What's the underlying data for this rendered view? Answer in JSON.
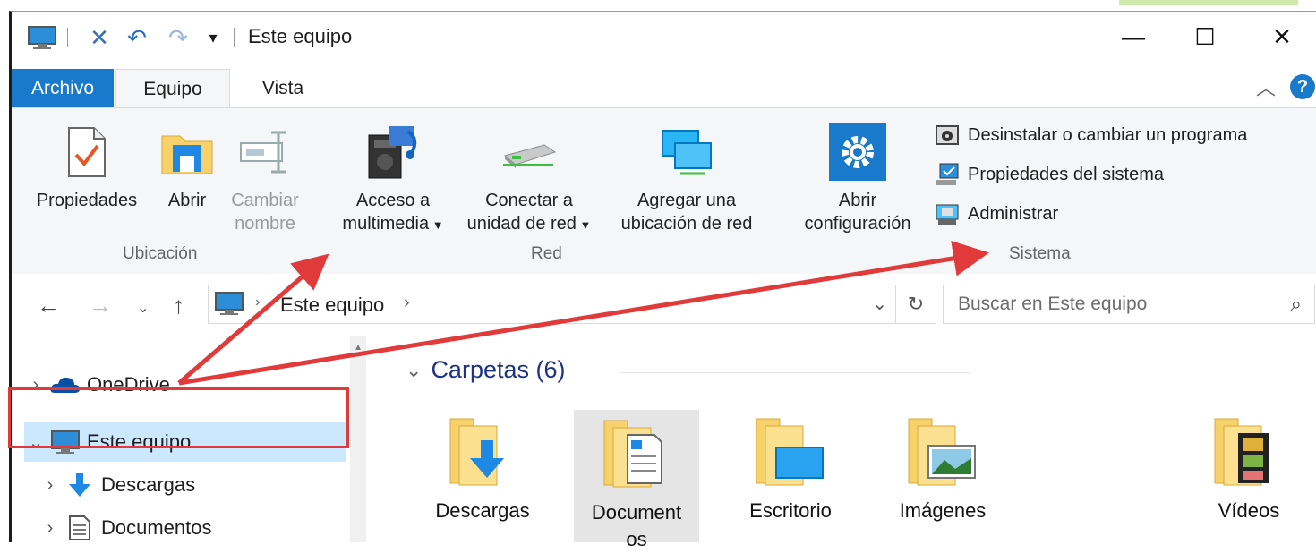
{
  "window": {
    "title": "Este equipo"
  },
  "ribbon": {
    "tabs": [
      {
        "label": "Archivo"
      },
      {
        "label": "Equipo"
      },
      {
        "label": "Vista"
      }
    ],
    "groups": {
      "ubicacion": {
        "label": "Ubicación",
        "buttons": [
          {
            "label": "Propiedades"
          },
          {
            "label": "Abrir"
          },
          {
            "label_line1": "Cambiar",
            "label_line2": "nombre"
          }
        ]
      },
      "red": {
        "label": "Red",
        "buttons": [
          {
            "label_line1": "Acceso a",
            "label_line2": "multimedia"
          },
          {
            "label_line1": "Conectar a",
            "label_line2": "unidad de red"
          },
          {
            "label_line1": "Agregar una",
            "label_line2": "ubicación de red"
          }
        ]
      },
      "sistema": {
        "label": "Sistema",
        "open_config": {
          "label_line1": "Abrir",
          "label_line2": "configuración"
        },
        "small_buttons": [
          {
            "label": "Desinstalar o cambiar un programa"
          },
          {
            "label": "Propiedades del sistema"
          },
          {
            "label": "Administrar"
          }
        ]
      }
    }
  },
  "navbar": {
    "breadcrumb": "Este equipo",
    "search_placeholder": "Buscar en Este equipo"
  },
  "nav_pane": {
    "items": [
      {
        "label": "OneDrive",
        "icon": "onedrive-icon"
      },
      {
        "label": "Este equipo",
        "icon": "computer-icon",
        "selected": true
      },
      {
        "label": "Descargas",
        "icon": "download-icon"
      },
      {
        "label": "Documentos",
        "icon": "document-icon"
      }
    ]
  },
  "content": {
    "group_header": "Carpetas (6)",
    "folders": [
      {
        "label": "Descargas"
      },
      {
        "label_line1": "Document",
        "label_line2": "os"
      },
      {
        "label": "Escritorio"
      },
      {
        "label": "Imágenes"
      },
      {
        "label": "Vídeos"
      }
    ]
  },
  "colors": {
    "accent": "#1979ca",
    "selection": "#cce8ff",
    "annotation_red": "#e03a3a",
    "group_header": "#1e3287"
  }
}
